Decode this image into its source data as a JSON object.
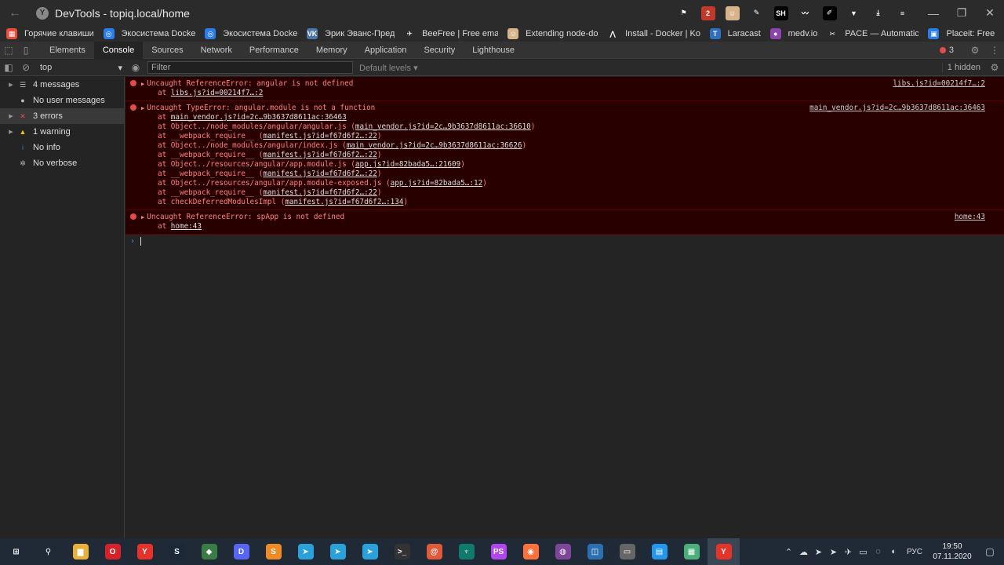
{
  "window": {
    "title": "DevTools - topiq.local/home",
    "site_icon": "Y",
    "controls": {
      "minimize": "—",
      "restore": "❐",
      "close": "✕"
    }
  },
  "extensions": [
    {
      "name": "bookmark-icon",
      "glyph": "⚑",
      "color": "transparent"
    },
    {
      "name": "ext-badge-icon",
      "glyph": "2",
      "color": "#c0392b"
    },
    {
      "name": "ext-face-icon",
      "glyph": "☺",
      "color": "#d8b48a"
    },
    {
      "name": "ext-feather-icon",
      "glyph": "✎",
      "color": "transparent"
    },
    {
      "name": "ext-sh-icon",
      "glyph": "SH",
      "color": "#000000"
    },
    {
      "name": "ext-wave-icon",
      "glyph": "〰",
      "color": "transparent"
    },
    {
      "name": "ext-pen-icon",
      "glyph": "✐",
      "color": "#000000"
    },
    {
      "name": "ext-vue-icon",
      "glyph": "▼",
      "color": "transparent"
    },
    {
      "name": "download-icon",
      "glyph": "⤓",
      "color": "transparent"
    },
    {
      "name": "menu-icon",
      "glyph": "≡",
      "color": "transparent"
    }
  ],
  "bookmarks": [
    {
      "label": "Горячие клавиши",
      "color": "#e74c3c",
      "glyph": "▦"
    },
    {
      "label": "Экосистема Docke",
      "color": "#2b7de9",
      "glyph": "◎"
    },
    {
      "label": "Экосистема Docke",
      "color": "#2b7de9",
      "glyph": "◎"
    },
    {
      "label": "Эрик Эванс-Пред",
      "color": "#4a76a8",
      "glyph": "VK"
    },
    {
      "label": "BeeFree | Free ema",
      "color": "transparent",
      "glyph": "✈"
    },
    {
      "label": "Extending node-do",
      "color": "#d8b48a",
      "glyph": "☺"
    },
    {
      "label": "Install - Docker | Ko",
      "color": "transparent",
      "glyph": "⋀"
    },
    {
      "label": "Laracast",
      "color": "#2e6fbf",
      "glyph": "T"
    },
    {
      "label": "medv.io",
      "color": "#8e44ad",
      "glyph": "●"
    },
    {
      "label": "PACE — Automatic",
      "color": "transparent",
      "glyph": "✂"
    },
    {
      "label": "Placeit: Free",
      "color": "#2b7de9",
      "glyph": "▣"
    }
  ],
  "devtools_tabs": [
    "Elements",
    "Console",
    "Sources",
    "Network",
    "Performance",
    "Memory",
    "Application",
    "Security",
    "Lighthouse"
  ],
  "active_tab": "Console",
  "error_badge": "3",
  "console_bar": {
    "context": "top",
    "filter_placeholder": "Filter",
    "levels": "Default levels ▾",
    "hidden": "1 hidden"
  },
  "sidebar": [
    {
      "label": "4 messages",
      "icon": "list-icon",
      "glyph": "☰",
      "color": "#bbb",
      "arrow": true,
      "selected": false
    },
    {
      "label": "No user messages",
      "icon": "user-icon",
      "glyph": "●",
      "color": "#bbb",
      "arrow": false,
      "selected": false
    },
    {
      "label": "3 errors",
      "icon": "error-icon",
      "glyph": "✕",
      "color": "#e34c4c",
      "arrow": true,
      "selected": true
    },
    {
      "label": "1 warning",
      "icon": "warning-icon",
      "glyph": "▲",
      "color": "#f0c020",
      "arrow": true,
      "selected": false
    },
    {
      "label": "No info",
      "icon": "info-icon",
      "glyph": "i",
      "color": "#2b7de9",
      "arrow": false,
      "selected": false
    },
    {
      "label": "No verbose",
      "icon": "bug-icon",
      "glyph": "✲",
      "color": "#bbb",
      "arrow": false,
      "selected": false
    }
  ],
  "messages": [
    {
      "text": "Uncaught ReferenceError: angular is not defined",
      "source": "libs.js?id=00214f7…:2",
      "stack": [
        {
          "pre": "at ",
          "link": "libs.js?id=00214f7…:2",
          "post": ""
        }
      ]
    },
    {
      "text": "Uncaught TypeError: angular.module is not a function",
      "source": "main_vendor.js?id=2c…9b3637d8611ac:36463",
      "stack": [
        {
          "pre": "at ",
          "link": "main_vendor.js?id=2c…9b3637d8611ac:36463",
          "post": ""
        },
        {
          "pre": "at Object../node_modules/angular/angular.js (",
          "link": "main_vendor.js?id=2c…9b3637d8611ac:36610",
          "post": ")"
        },
        {
          "pre": "at __webpack_require__ (",
          "link": "manifest.js?id=f67d6f2…:22",
          "post": ")"
        },
        {
          "pre": "at Object../node_modules/angular/index.js (",
          "link": "main_vendor.js?id=2c…9b3637d8611ac:36626",
          "post": ")"
        },
        {
          "pre": "at __webpack_require__ (",
          "link": "manifest.js?id=f67d6f2…:22",
          "post": ")"
        },
        {
          "pre": "at Object../resources/angular/app.module.js (",
          "link": "app.js?id=82bada5…:21609",
          "post": ")"
        },
        {
          "pre": "at __webpack_require__ (",
          "link": "manifest.js?id=f67d6f2…:22",
          "post": ")"
        },
        {
          "pre": "at Object../resources/angular/app.module-exposed.js (",
          "link": "app.js?id=82bada5…:12",
          "post": ")"
        },
        {
          "pre": "at __webpack_require__ (",
          "link": "manifest.js?id=f67d6f2…:22",
          "post": ")"
        },
        {
          "pre": "at checkDeferredModulesImpl (",
          "link": "manifest.js?id=f67d6f2…:134",
          "post": ")"
        }
      ]
    },
    {
      "text": "Uncaught ReferenceError: spApp is not defined",
      "source": "home:43",
      "stack": [
        {
          "pre": "at ",
          "link": "home:43",
          "post": ""
        }
      ]
    }
  ],
  "taskbar": {
    "apps": [
      {
        "name": "windows-start-icon",
        "glyph": "⊞",
        "color": "transparent"
      },
      {
        "name": "search-icon",
        "glyph": "⚲",
        "color": "transparent"
      },
      {
        "name": "file-explorer-icon",
        "glyph": "▆",
        "color": "#e8b23a"
      },
      {
        "name": "opera-icon",
        "glyph": "O",
        "color": "#d4212a"
      },
      {
        "name": "yandex-browser-icon",
        "glyph": "Y",
        "color": "#e63228"
      },
      {
        "name": "steam-icon",
        "glyph": "S",
        "color": "#1b2838"
      },
      {
        "name": "network-app-icon",
        "glyph": "◆",
        "color": "#3a7d44"
      },
      {
        "name": "discord-icon",
        "glyph": "D",
        "color": "#5865f2"
      },
      {
        "name": "sublime-icon",
        "glyph": "S",
        "color": "#f08a24"
      },
      {
        "name": "telegram-icon",
        "glyph": "➤",
        "color": "#2aa1da"
      },
      {
        "name": "telegram-icon-2",
        "glyph": "➤",
        "color": "#2aa1da"
      },
      {
        "name": "telegram-icon-3",
        "glyph": "➤",
        "color": "#2aa1da"
      },
      {
        "name": "terminal-icon",
        "glyph": ">_",
        "color": "#333333"
      },
      {
        "name": "snail-icon",
        "glyph": "@",
        "color": "#e05a3a"
      },
      {
        "name": "gitkraken-icon",
        "glyph": "♆",
        "color": "#0f7b6c"
      },
      {
        "name": "phpstorm-icon",
        "glyph": "PS",
        "color": "#b345f1"
      },
      {
        "name": "firefox-icon",
        "glyph": "◉",
        "color": "#ff7139"
      },
      {
        "name": "tor-icon",
        "glyph": "◍",
        "color": "#7d4698"
      },
      {
        "name": "vscode-icon",
        "glyph": "◫",
        "color": "#2a6fb0"
      },
      {
        "name": "remote-desktop-icon",
        "glyph": "▭",
        "color": "#666666"
      },
      {
        "name": "docker-icon",
        "glyph": "▤",
        "color": "#2396ed"
      },
      {
        "name": "notepad-icon",
        "glyph": "▦",
        "color": "#4caf7a"
      },
      {
        "name": "yandex-browser-active-icon",
        "glyph": "Y",
        "color": "#e63228"
      }
    ],
    "tray": [
      "⌃",
      "☁",
      "➤",
      "➤",
      "✈",
      "▭",
      "◌",
      "◖"
    ],
    "language": "РУС",
    "time": "19:50",
    "date": "07.11.2020"
  }
}
